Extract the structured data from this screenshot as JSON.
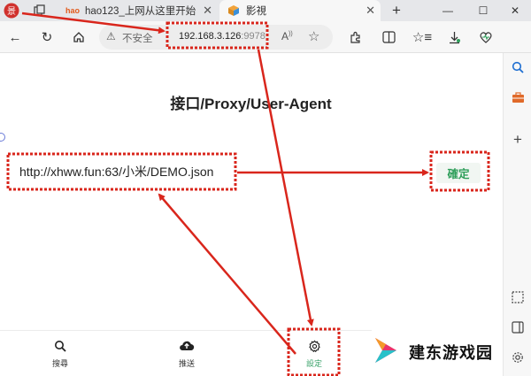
{
  "tabs": [
    {
      "title": "hao123_上网从这里开始",
      "favicon": "hao-logo"
    },
    {
      "title": "影視",
      "favicon": "cube-icon"
    }
  ],
  "address_bar": {
    "security_text": "不安全",
    "host": "192.168.3.126",
    "port": ":9978"
  },
  "page": {
    "title": "接口/Proxy/User-Agent",
    "url_input_value": "http://xhww.fun:63/小米/DEMO.json",
    "confirm_label": "確定"
  },
  "bottom_nav": [
    {
      "label": "搜尋",
      "icon": "search-icon"
    },
    {
      "label": "推送",
      "icon": "cloud-upload-icon"
    },
    {
      "label": "設定",
      "icon": "gear-icon"
    }
  ],
  "watermark": {
    "text": "建东游戏园"
  },
  "colors": {
    "annotation_red": "#d9261c",
    "accent_green": "#2e9e5a",
    "tab_strip": "#e6e7ea",
    "toolbar": "#f7f7f7"
  }
}
